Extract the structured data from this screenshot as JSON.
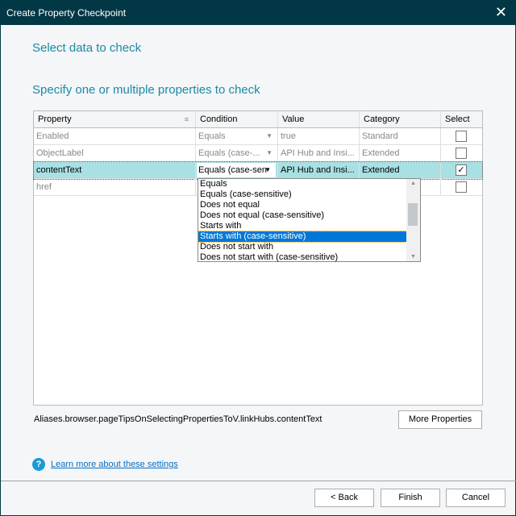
{
  "window": {
    "title": "Create Property Checkpoint",
    "close_icon": "close-icon"
  },
  "heading1": "Select data to check",
  "heading2": "Specify one or multiple properties to check",
  "grid": {
    "columns": [
      "Property",
      "Condition",
      "Value",
      "Category",
      "Select"
    ],
    "rows": [
      {
        "property": "Enabled",
        "condition": "Equals",
        "value": "true",
        "category": "Standard",
        "selected": false
      },
      {
        "property": "ObjectLabel",
        "condition": "Equals (case-...",
        "value": "API Hub and Insi...",
        "category": "Extended",
        "selected": false
      },
      {
        "property": "contentText",
        "condition": "Equals (case-sen",
        "value": "API Hub and Insi...",
        "category": "Extended",
        "selected": true
      },
      {
        "property": "href",
        "condition": "",
        "value": "",
        "category": "",
        "selected": false
      }
    ]
  },
  "dropdown": {
    "options": [
      "Equals",
      "Equals (case-sensitive)",
      "Does not equal",
      "Does not equal (case-sensitive)",
      "Starts with",
      "Starts with (case-sensitive)",
      "Does not start with",
      "Does not start with (case-sensitive)"
    ],
    "highlighted": "Starts with (case-sensitive)"
  },
  "object_path": "Aliases.browser.pageTipsOnSelectingPropertiesToV.linkHubs.contentText",
  "more_properties": "More Properties",
  "help_link": "Learn more about these settings",
  "buttons": {
    "back": "< Back",
    "finish": "Finish",
    "cancel": "Cancel"
  },
  "check_mark": "✓"
}
